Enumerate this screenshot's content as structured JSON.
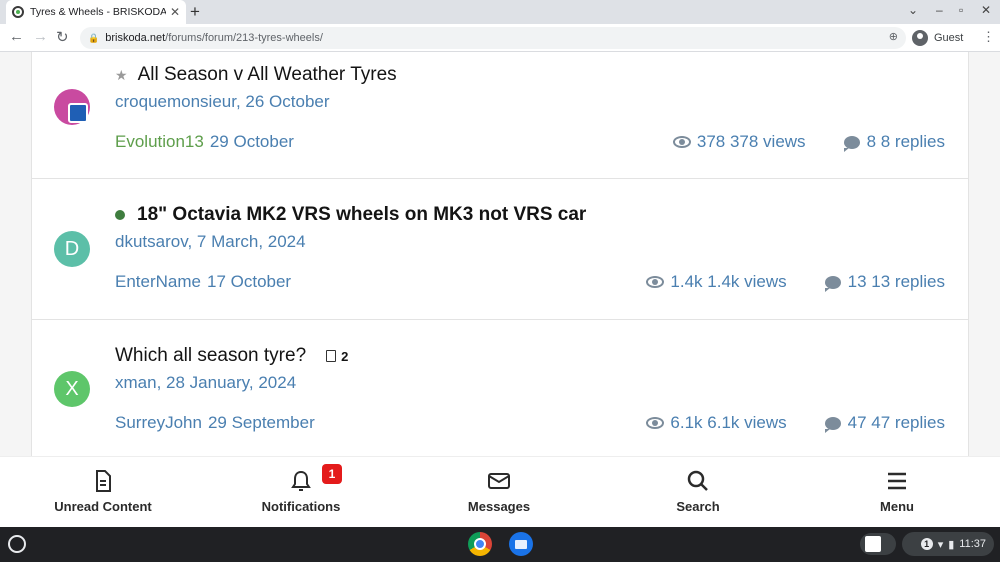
{
  "browser": {
    "tab_title": "Tyres & Wheels - BRISKODA",
    "url_host": "briskoda.net",
    "url_path": "/forums/forum/213-tyres-wheels/",
    "profile": "Guest"
  },
  "threads": [
    {
      "title": "All Season v All Weather Tyres",
      "starter": "croquemonsieur",
      "start_date": "26 October",
      "last_poster": "Evolution13",
      "last_date": "29 October",
      "views": "378 378 views",
      "replies": "8 8 replies",
      "avatar_letter": "",
      "avatar_color": "#c94aa0",
      "unread": false
    },
    {
      "title": "18\" Octavia MK2 VRS wheels on MK3 not VRS car",
      "starter": "dkutsarov",
      "start_date": "7 March, 2024",
      "last_poster": "EnterName",
      "last_date": "17 October",
      "views": "1.4k 1.4k views",
      "replies": "13 13 replies",
      "avatar_letter": "D",
      "avatar_color": "#5cbfa8",
      "unread": true
    },
    {
      "title": "Which all season tyre?",
      "pages": "2",
      "starter": "xman",
      "start_date": "28 January, 2024",
      "last_poster": "SurreyJohn",
      "last_date": "29 September",
      "views": "6.1k 6.1k views",
      "replies": "47 47 replies",
      "avatar_letter": "X",
      "avatar_color": "#5ec66a",
      "unread": false
    }
  ],
  "bottom_nav": {
    "unread": "Unread Content",
    "notifications": "Notifications",
    "notifications_count": "1",
    "messages": "Messages",
    "search": "Search",
    "menu": "Menu"
  },
  "shelf": {
    "tray_badge": "1",
    "time": "11:37"
  }
}
